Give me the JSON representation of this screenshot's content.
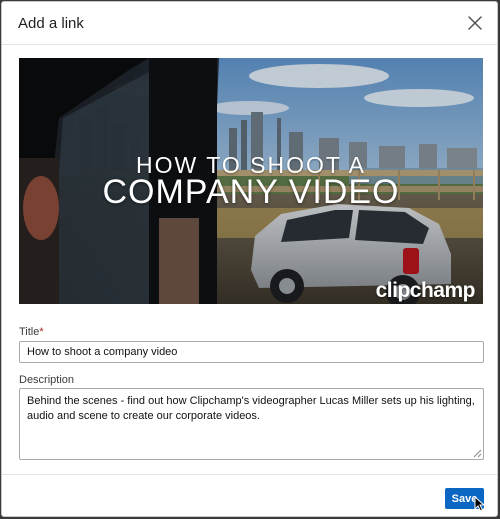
{
  "dialog": {
    "title": "Add a link",
    "close_icon": "close-icon"
  },
  "preview": {
    "headline_top": "HOW TO SHOOT A",
    "headline_main": "COMPANY VIDEO",
    "watermark": "clipchamp"
  },
  "form": {
    "title_label": "Title",
    "required_marker": "*",
    "title_value": "How to shoot a company video",
    "description_label": "Description",
    "description_value": "Behind the scenes - find out how Clipchamp's videographer Lucas Miller sets up his lighting, audio and scene to create our corporate videos."
  },
  "footer": {
    "save_label": "Save"
  },
  "colors": {
    "accent": "#0a66c2",
    "required": "#b0211e"
  }
}
